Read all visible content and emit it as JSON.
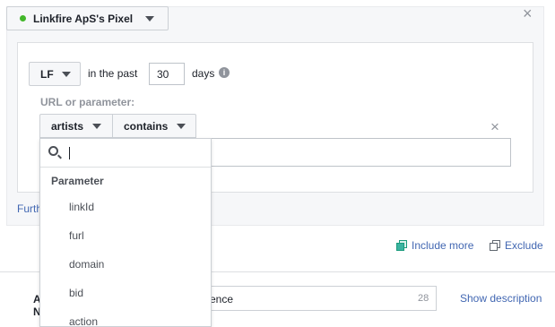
{
  "pixel": {
    "name": "Linkfire ApS's Pixel",
    "status_color": "#42b72a"
  },
  "rule": {
    "event_select": "LF",
    "in_the_past": "in the past",
    "days_value": "30",
    "days_label": "days",
    "info_icon": "i",
    "url_label": "URL or parameter:",
    "param_select": "artists",
    "operator_select": "contains",
    "value": ""
  },
  "dropdown": {
    "search_value": "",
    "header": "Parameter",
    "items": [
      "linkId",
      "furl",
      "domain",
      "bid",
      "action"
    ]
  },
  "further_link": "Further",
  "actions": {
    "include_more": "Include more",
    "exclude": "Exclude"
  },
  "audience": {
    "label": "Audience Name",
    "value": "ence",
    "char_count": "28",
    "show_description": "Show description"
  },
  "icons": {
    "close": "×"
  },
  "colors": {
    "link": "#4267b2",
    "include_icon": "#1a9b7c"
  }
}
